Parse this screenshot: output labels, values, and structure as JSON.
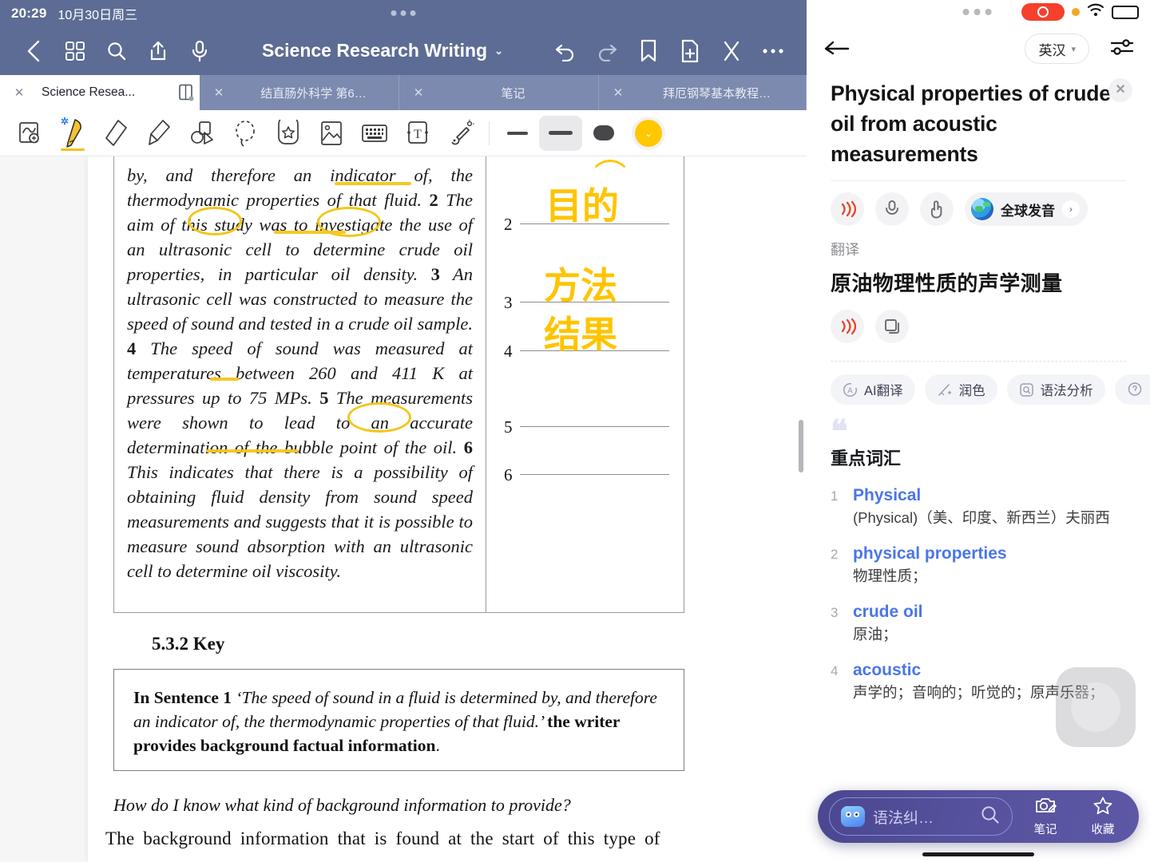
{
  "reader": {
    "status": {
      "time": "20:29",
      "date": "10月30日周三"
    },
    "topbar": {
      "title": "Science Research Writing",
      "caret": "⌄",
      "icons": [
        "back-icon",
        "grid-icon",
        "search-icon",
        "share-icon",
        "mic-icon",
        "undo-icon",
        "redo-icon",
        "bookmark-icon",
        "add-page-icon",
        "close-x-icon",
        "more-icon"
      ]
    },
    "tabs": [
      {
        "label": "Science Resea...",
        "close": "✕",
        "active": true
      },
      {
        "label": "结直肠外科学 第6…",
        "close": "✕",
        "active": false
      },
      {
        "label": "笔记",
        "close": "✕",
        "active": false
      },
      {
        "label": "拜厄钢琴基本教程…",
        "close": "✕",
        "active": false
      }
    ],
    "tools": [
      "lasso-zoom-icon",
      "pen-icon",
      "eraser-icon",
      "highlighter-icon",
      "shape-icon",
      "lasso-select-icon",
      "sticker-icon",
      "image-icon",
      "keyboard-icon",
      "text-box-icon",
      "laser-pointer-icon"
    ],
    "stroke": {
      "thin": "stroke-thin",
      "medium": "stroke-medium",
      "thick": "stroke-thick",
      "color": "#FFC800"
    },
    "bluetooth_badge": "✲",
    "document": {
      "paragraph": [
        "by, and therefore an indicator of, the thermodynamic properties of that fluid. ",
        "2",
        " The aim of this study was to investigate the use of an ultrasonic cell to determine crude oil properties, in particular oil density. ",
        "3",
        " An ultrasonic cell was constructed to measure the speed of sound and tested in a crude oil sample. ",
        "4",
        " The speed of sound was measured at temperatures between 260 and 411 K at pressures up to 75 MPs. ",
        "5",
        " The measurements were shown to lead to an accurate determination of the bubble point of the oil. ",
        "6",
        " This indicates that there is a possibility of obtaining fluid density from sound speed measurements and suggests that it is possible to measure sound absorption with an ultrasonic cell to determine oil viscosity."
      ],
      "blanks": [
        {
          "num": "2",
          "handwriting": "目的"
        },
        {
          "num": "3",
          "handwriting": "方法"
        },
        {
          "num": "4",
          "handwriting": "结果"
        },
        {
          "num": "5",
          "handwriting": ""
        },
        {
          "num": "6",
          "handwriting": ""
        }
      ],
      "key_heading": "5.3.2  Key",
      "key_box": {
        "lead": "In Sentence 1 ",
        "quote": "‘The speed of sound in a fluid is determined by, and therefore an indicator of, the thermodynamic properties of that fluid.’ ",
        "answer": "the writer provides background factual information",
        "period": "."
      },
      "question": "How do I know what kind of background information to provide?",
      "body_text": "The background information that is found at the start of this type of"
    }
  },
  "translator": {
    "status": {
      "recording": "rec-pill",
      "wifi": "wifi-icon",
      "battery": "battery-icon"
    },
    "nav": {
      "back": "back-arrow-icon",
      "lang": "英汉",
      "lang_caret": "▾",
      "settings": "sliders-icon"
    },
    "title": "Physical properties of crude oil from acoustic measurements",
    "close": "✕",
    "source_actions": {
      "speak": "speaker-icon",
      "mic": "mic-icon",
      "hand": "hand-tap-icon",
      "global_pron": "全球发音",
      "global_chevron": "›"
    },
    "translation_label": "翻译",
    "translation_text": "原油物理性质的声学测量",
    "translation_actions": {
      "speak": "speaker-icon",
      "copy": "copy-icon"
    },
    "chips": [
      {
        "icon": "circle-a-icon",
        "label": "AI翻译"
      },
      {
        "icon": "magic-wand-icon",
        "label": "润色"
      },
      {
        "icon": "grammar-box-icon",
        "label": "语法分析"
      },
      {
        "icon": "partial-icon",
        "label": ""
      }
    ],
    "vocab_title": "重点词汇",
    "vocab": [
      {
        "num": "1",
        "word": "Physical",
        "def": "(Physical)（美、印度、新西兰）夫丽西"
      },
      {
        "num": "2",
        "word": "physical properties",
        "def": "物理性质；"
      },
      {
        "num": "3",
        "word": "crude oil",
        "def": "原油；"
      },
      {
        "num": "4",
        "word": "acoustic",
        "def": "声学的；音响的；听觉的；原声乐器；"
      }
    ],
    "bottom": {
      "search_placeholder": "语法纠…",
      "search_icon": "search-icon",
      "note": {
        "icon": "camera-note-icon",
        "label": "笔记"
      },
      "favorite": {
        "icon": "star-icon",
        "label": "收藏"
      }
    }
  }
}
